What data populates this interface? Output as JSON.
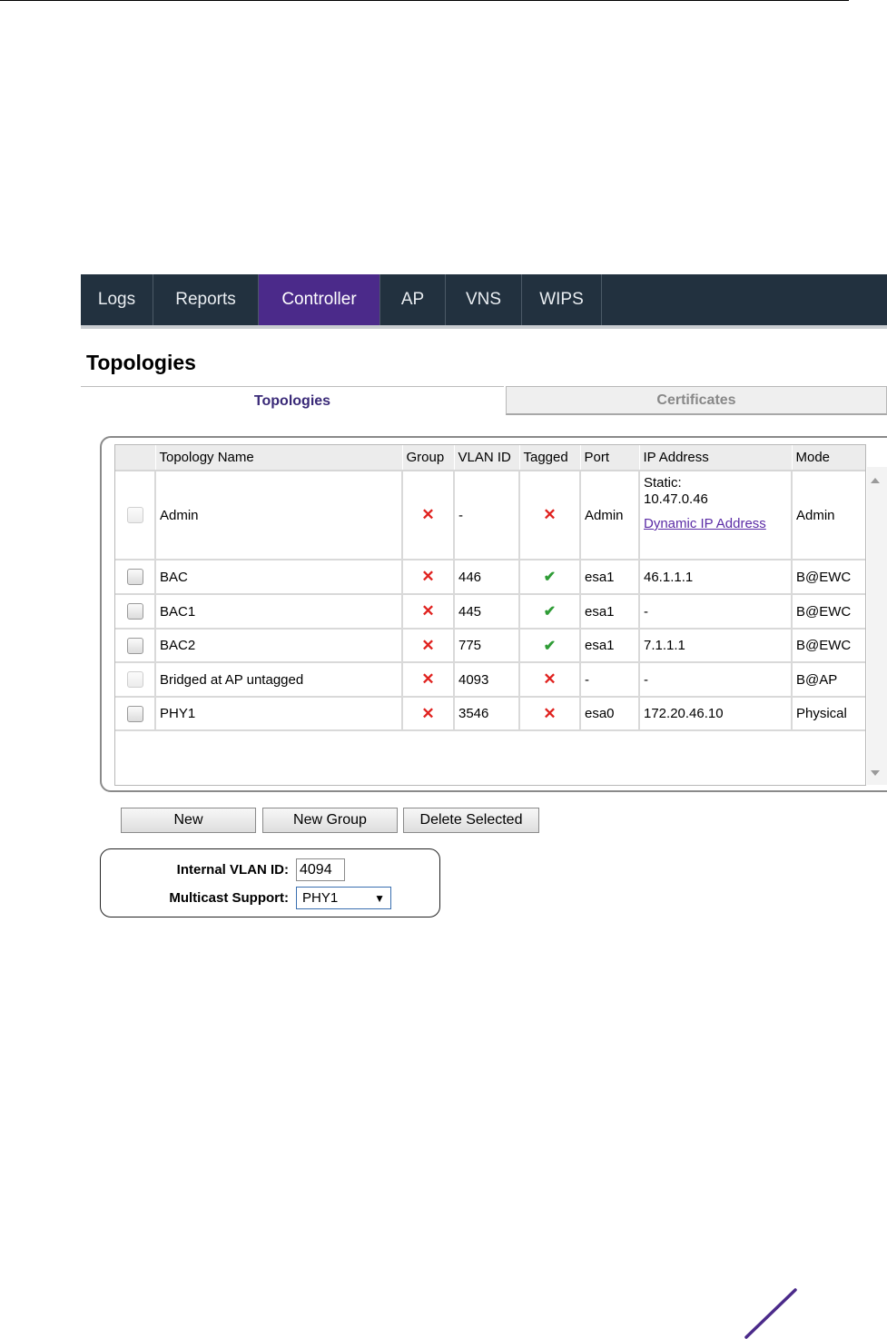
{
  "nav": {
    "items": [
      {
        "label": "Logs",
        "active": false
      },
      {
        "label": "Reports",
        "active": false
      },
      {
        "label": "Controller",
        "active": true
      },
      {
        "label": "AP",
        "active": false
      },
      {
        "label": "VNS",
        "active": false
      },
      {
        "label": "WIPS",
        "active": false
      }
    ]
  },
  "page": {
    "title": "Topologies"
  },
  "tabs": {
    "topologies": "Topologies",
    "certificates": "Certificates"
  },
  "table": {
    "headers": {
      "name": "Topology Name",
      "group": "Group",
      "vlan": "VLAN ID",
      "tagged": "Tagged",
      "port": "Port",
      "ip": "IP Address",
      "mode": "Mode"
    },
    "rows": [
      {
        "name": "Admin",
        "vlan": "-",
        "port": "Admin",
        "ip_static": "Static:",
        "ip_value": "10.47.0.46",
        "ip_link": "Dynamic IP Address",
        "mode": "Admin"
      },
      {
        "name": "BAC",
        "vlan": "446",
        "port": "esa1",
        "ip": "46.1.1.1",
        "mode": "B@EWC"
      },
      {
        "name": "BAC1",
        "vlan": "445",
        "port": "esa1",
        "ip": "-",
        "mode": "B@EWC"
      },
      {
        "name": "BAC2",
        "vlan": "775",
        "port": "esa1",
        "ip": "7.1.1.1",
        "mode": "B@EWC"
      },
      {
        "name": "Bridged at AP untagged",
        "vlan": "4093",
        "port": "-",
        "ip": "-",
        "mode": "B@AP"
      },
      {
        "name": "PHY1",
        "vlan": "3546",
        "port": "esa0",
        "ip": "172.20.46.10",
        "mode": "Physical"
      }
    ],
    "icons": {
      "no": "✕",
      "yes": "✔"
    }
  },
  "buttons": {
    "new": "New",
    "new_group": "New Group",
    "delete_selected": "Delete Selected"
  },
  "settings": {
    "vlan_label": "Internal VLAN ID:",
    "vlan_value": "4094",
    "multicast_label": "Multicast Support:",
    "multicast_value": "PHY1",
    "dropdown_arrow": "▼"
  },
  "colors": {
    "nav_bg": "#22313f",
    "active_tab": "#4b2a8a",
    "error": "#e0221f",
    "ok": "#2f9c36",
    "link": "#5b2ca6"
  }
}
